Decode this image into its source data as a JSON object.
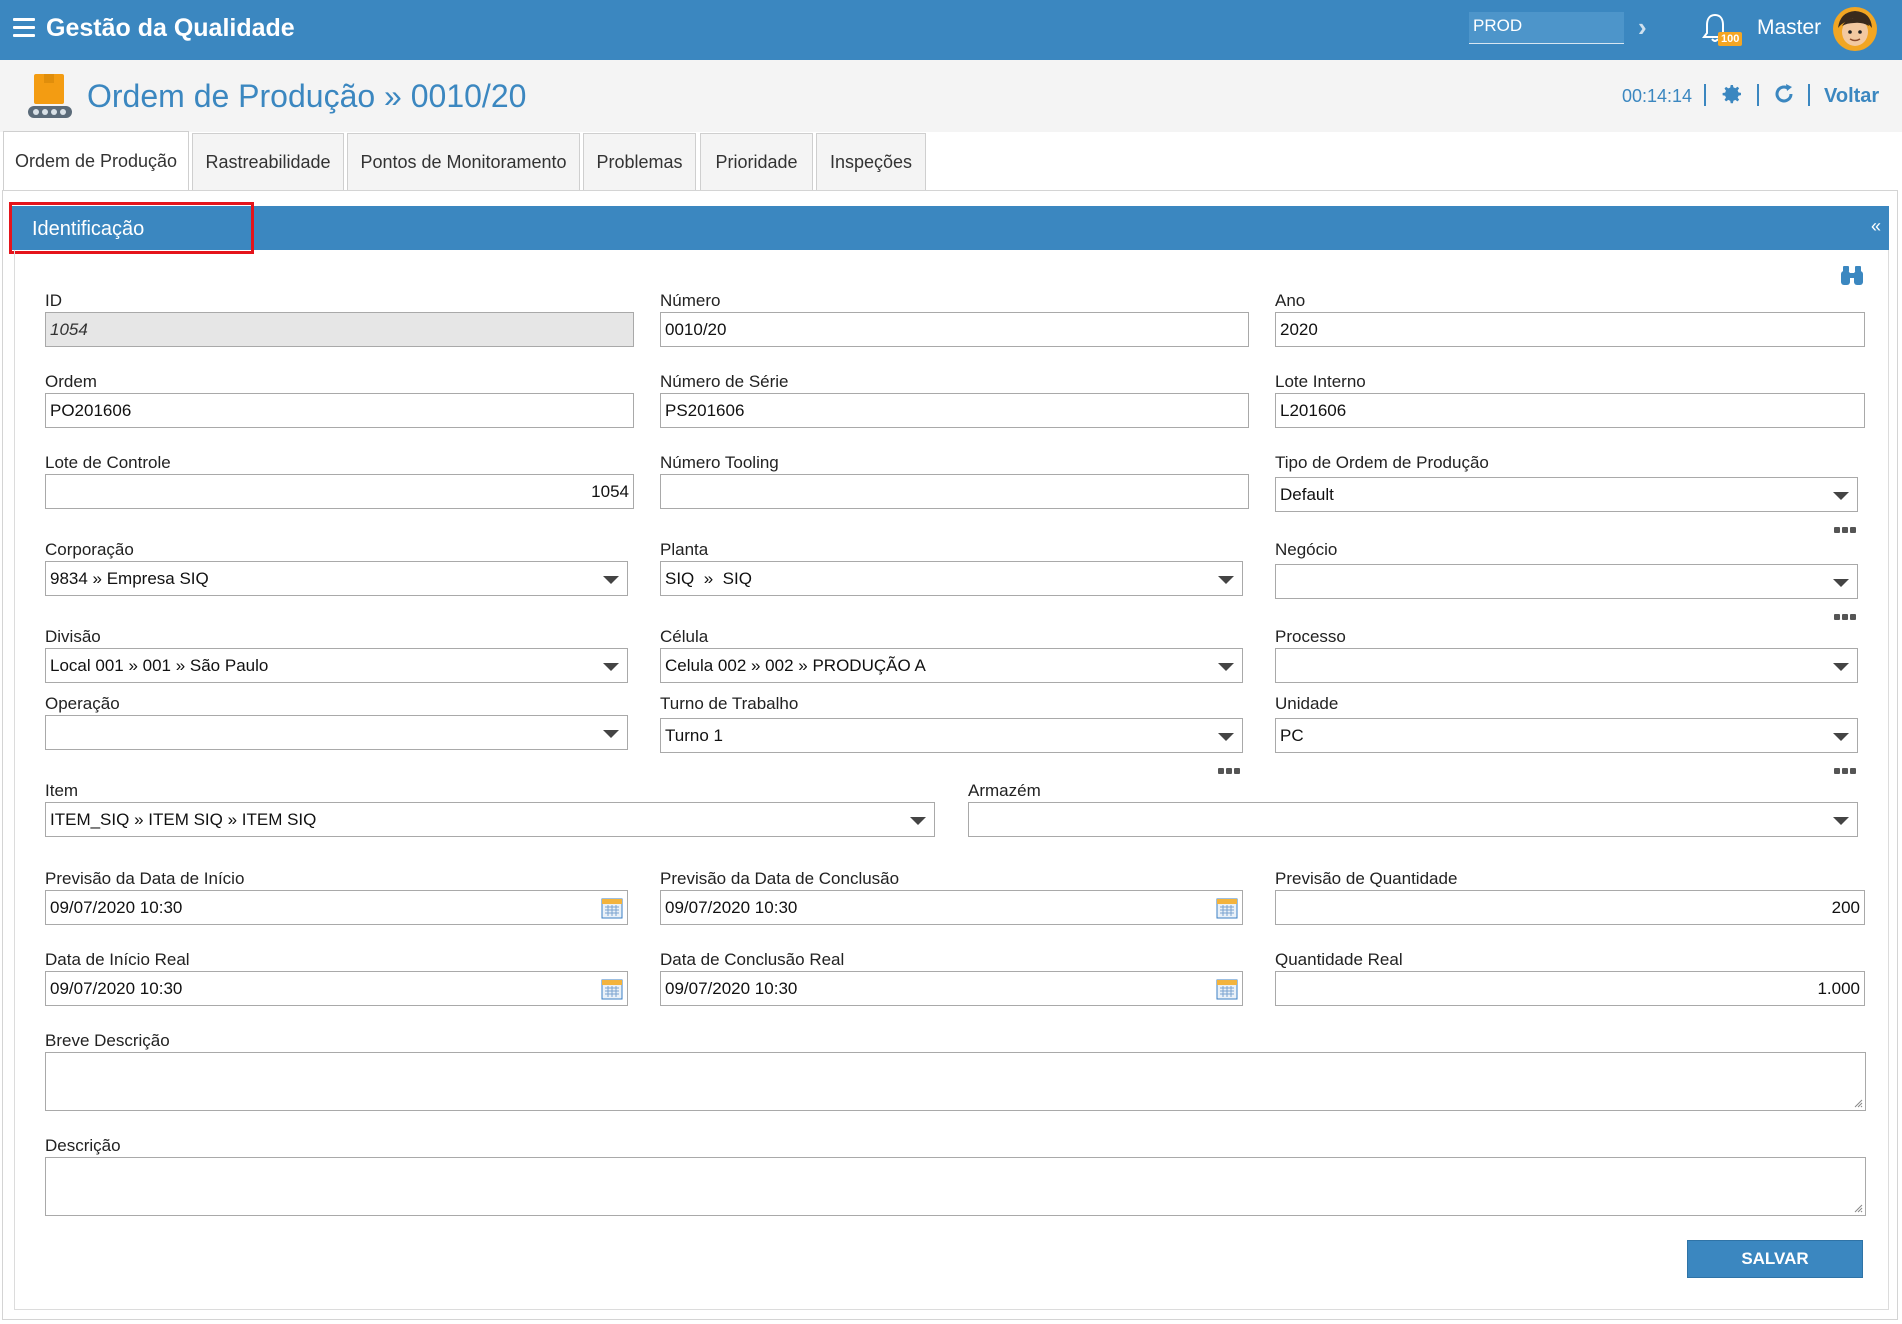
{
  "app": {
    "title": "Gestão da Qualidade",
    "environment": "PROD",
    "notification_count": "100",
    "user_name": "Master",
    "brand_color": "#3b87c0"
  },
  "header": {
    "title": "Ordem de Produção » 0010/20",
    "timer": "00:14:14",
    "back_label": "Voltar"
  },
  "tabs": [
    {
      "label": "Ordem de Produção",
      "active": true
    },
    {
      "label": "Rastreabilidade"
    },
    {
      "label": "Pontos de Monitoramento"
    },
    {
      "label": "Problemas"
    },
    {
      "label": "Prioridade"
    },
    {
      "label": "Inspeções"
    }
  ],
  "section": {
    "title": "Identificação",
    "collapse_label": "«"
  },
  "fields": {
    "id": {
      "label": "ID",
      "value": "1054"
    },
    "numero": {
      "label": "Número",
      "value": "0010/20"
    },
    "ano": {
      "label": "Ano",
      "value": "2020"
    },
    "ordem": {
      "label": "Ordem",
      "value": "PO201606"
    },
    "numero_serie": {
      "label": "Número de Série",
      "value": "PS201606"
    },
    "lote_interno": {
      "label": "Lote Interno",
      "value": "L201606"
    },
    "lote_controle": {
      "label": "Lote de Controle",
      "value": "1054"
    },
    "numero_tooling": {
      "label": "Número Tooling",
      "value": ""
    },
    "tipo_ordem": {
      "label": "Tipo de Ordem de Produção",
      "value": "Default"
    },
    "corporacao": {
      "label": "Corporação",
      "value": "9834 » Empresa SIQ"
    },
    "planta": {
      "label": "Planta",
      "value": "SIQ  »  SIQ"
    },
    "negocio": {
      "label": "Negócio",
      "value": ""
    },
    "divisao": {
      "label": "Divisão",
      "value": "Local 001 » 001 » São Paulo"
    },
    "celula": {
      "label": "Célula",
      "value": "Celula 002 » 002 » PRODUÇÃO A"
    },
    "processo": {
      "label": "Processo",
      "value": ""
    },
    "operacao": {
      "label": "Operação",
      "value": ""
    },
    "turno": {
      "label": "Turno de Trabalho",
      "value": "Turno 1"
    },
    "unidade": {
      "label": "Unidade",
      "value": "PC"
    },
    "item": {
      "label": "Item",
      "value": "ITEM_SIQ » ITEM SIQ » ITEM SIQ"
    },
    "armazem": {
      "label": "Armazém",
      "value": ""
    },
    "prev_inicio": {
      "label": "Previsão da Data de Início",
      "value": "09/07/2020 10:30"
    },
    "prev_conclusao": {
      "label": "Previsão da Data de Conclusão",
      "value": "09/07/2020 10:30"
    },
    "prev_quantidade": {
      "label": "Previsão de Quantidade",
      "value": "200"
    },
    "inicio_real": {
      "label": "Data de Início Real",
      "value": "09/07/2020 10:30"
    },
    "conclusao_real": {
      "label": "Data de Conclusão Real",
      "value": "09/07/2020 10:30"
    },
    "quantidade_real": {
      "label": "Quantidade Real",
      "value": "1.000"
    },
    "breve_descricao": {
      "label": "Breve Descrição",
      "value": ""
    },
    "descricao": {
      "label": "Descrição",
      "value": ""
    }
  },
  "actions": {
    "save_label": "SALVAR"
  }
}
